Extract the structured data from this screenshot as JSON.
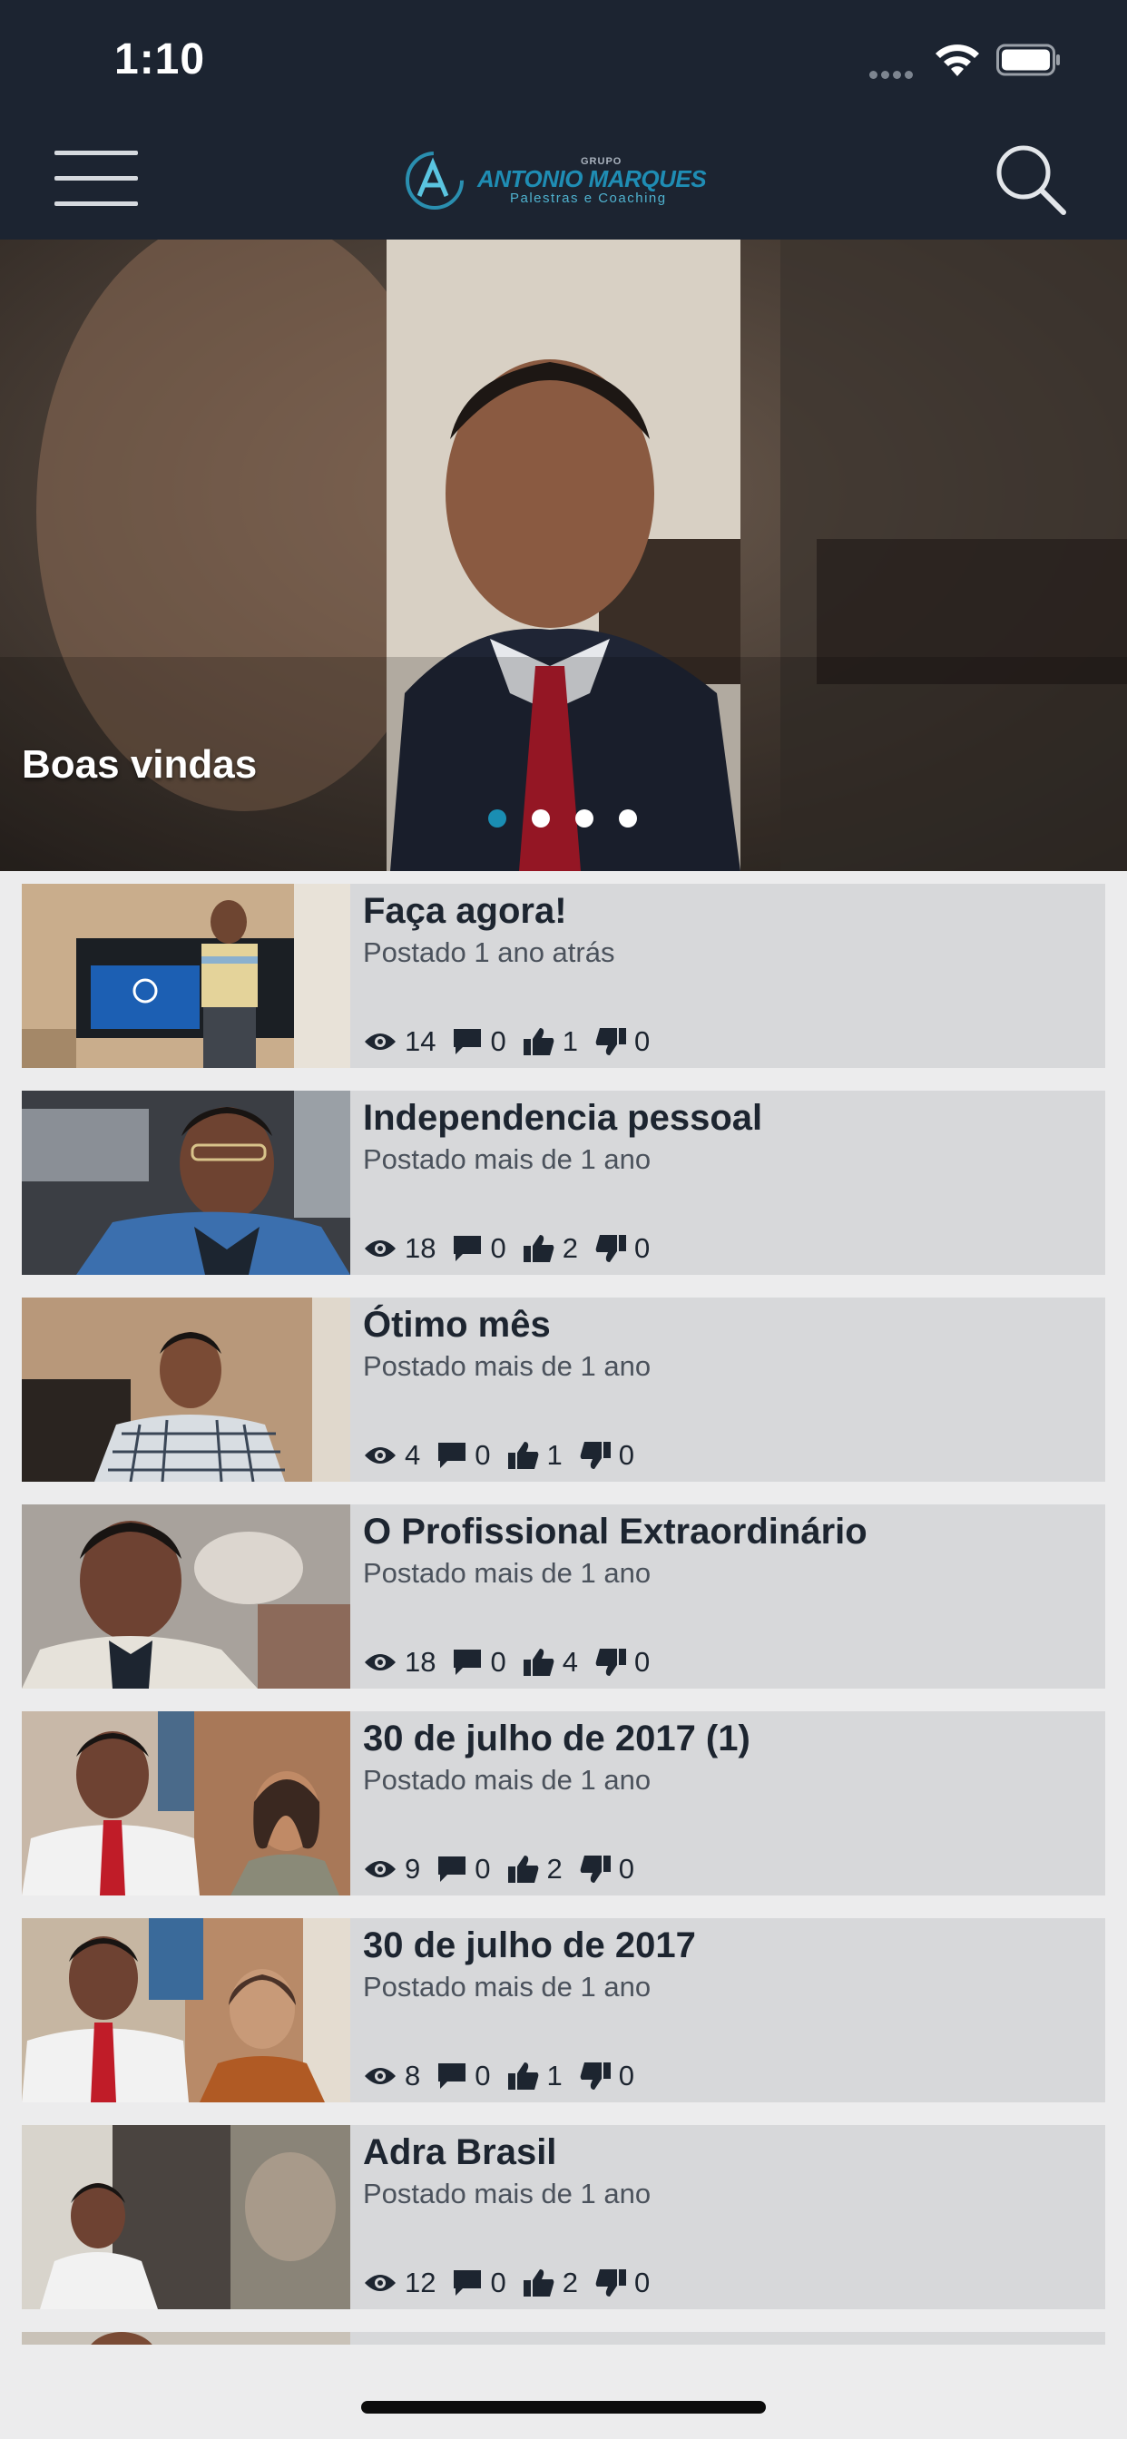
{
  "status_bar": {
    "time": "1:10"
  },
  "header": {
    "logo": {
      "grupo": "GRUPO",
      "name": "ANTONIO MARQUES",
      "tagline": "Palestras e Coaching"
    }
  },
  "hero": {
    "title": "Boas vindas",
    "dots": 4,
    "active_dot": 0
  },
  "videos": [
    {
      "title": "Faça agora!",
      "posted": "Postado 1 ano atrás",
      "views": "14",
      "comments": "0",
      "likes": "1",
      "dislikes": "0"
    },
    {
      "title": "Independencia pessoal",
      "posted": "Postado mais de 1 ano",
      "views": "18",
      "comments": "0",
      "likes": "2",
      "dislikes": "0"
    },
    {
      "title": "Ótimo mês",
      "posted": "Postado mais de 1 ano",
      "views": "4",
      "comments": "0",
      "likes": "1",
      "dislikes": "0"
    },
    {
      "title": "O Profissional Extraordinário",
      "posted": "Postado mais de 1 ano",
      "views": "18",
      "comments": "0",
      "likes": "4",
      "dislikes": "0"
    },
    {
      "title": "30 de julho de 2017 (1)",
      "posted": "Postado mais de 1 ano",
      "views": "9",
      "comments": "0",
      "likes": "2",
      "dislikes": "0"
    },
    {
      "title": "30 de julho de 2017",
      "posted": "Postado mais de 1 ano",
      "views": "8",
      "comments": "0",
      "likes": "1",
      "dislikes": "0"
    },
    {
      "title": "Adra Brasil",
      "posted": "Postado mais de 1 ano",
      "views": "12",
      "comments": "0",
      "likes": "2",
      "dislikes": "0"
    }
  ],
  "colors": {
    "header_bg": "#1c2431",
    "accent": "#1a8eb3",
    "card_bg": "#d7d8da"
  }
}
